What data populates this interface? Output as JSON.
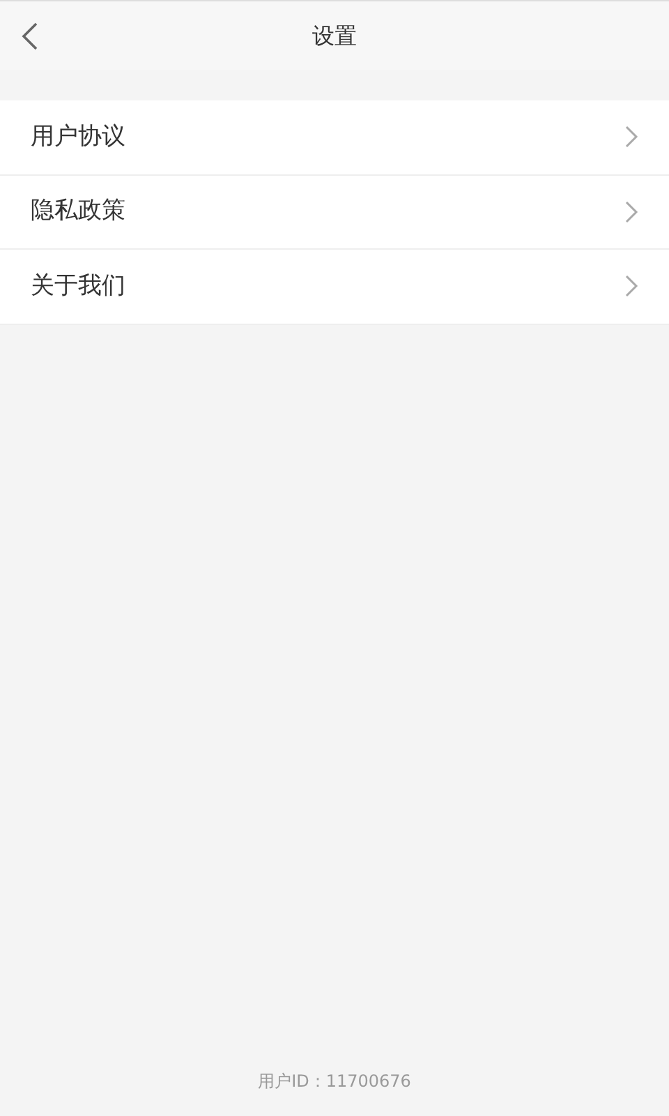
{
  "header": {
    "title": "设置"
  },
  "menu": [
    {
      "label": "用户协议"
    },
    {
      "label": "隐私政策"
    },
    {
      "label": "关于我们"
    }
  ],
  "footer": {
    "user_id": "用户ID：11700676"
  }
}
